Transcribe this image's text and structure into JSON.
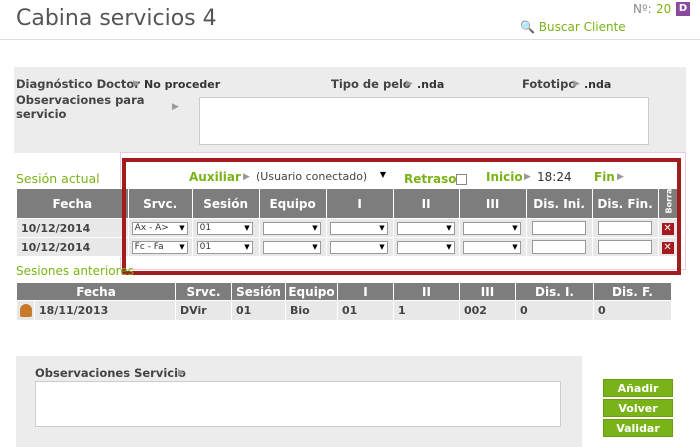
{
  "header": {
    "title": "Cabina servicios 4",
    "num_label": "Nº:",
    "num_value": "20",
    "badge": "D",
    "buscar": "Buscar Cliente"
  },
  "diagnostic": {
    "doctor_label": "Diagnóstico Doctor",
    "doctor_value": "No proceder",
    "tipo_label": "Tipo de pelo",
    "tipo_value": ".nda",
    "foto_label": "Fototipo",
    "foto_value": ".nda",
    "obs_label_1": "Observaciones para",
    "obs_label_2": "servicio"
  },
  "session": {
    "title": "Sesión actual",
    "auxiliar_label": "Auxiliar",
    "auxiliar_value": "(Usuario conectado)",
    "retraso_label": "Retraso",
    "inicio_label": "Inicio",
    "inicio_value": "18:24",
    "fin_label": "Fin",
    "headers": [
      "Fecha",
      "Srvc.",
      "Sesión",
      "Equipo",
      "I",
      "II",
      "III",
      "Dis. Ini.",
      "Dis. Fin.",
      "Borrar"
    ],
    "rows": [
      {
        "fecha": "10/12/2014",
        "srvc": "Ax - A>",
        "sesion": "01"
      },
      {
        "fecha": "10/12/2014",
        "srvc": "Fc - Fa",
        "sesion": "01"
      }
    ]
  },
  "previous": {
    "title": "Sesiones anteriores",
    "headers": [
      "Fecha",
      "Srvc.",
      "Sesión",
      "Equipo",
      "I",
      "II",
      "III",
      "Dis. I.",
      "Dis. F."
    ],
    "rows": [
      {
        "fecha": "18/11/2013",
        "srvc": "DVir",
        "sesion": "01",
        "equipo": "Bio",
        "i": "01",
        "ii": "1",
        "iii": "002",
        "disi": "0",
        "disf": "0"
      }
    ]
  },
  "footer": {
    "obs_label": "Observaciones Servicio",
    "btn_add": "Añadir",
    "btn_back": "Volver",
    "btn_validate": "Validar"
  },
  "colors": {
    "accent": "#7ab317",
    "header_bg": "#7d7d7d",
    "highlight": "#a11d1d",
    "delete": "#a6191e"
  }
}
